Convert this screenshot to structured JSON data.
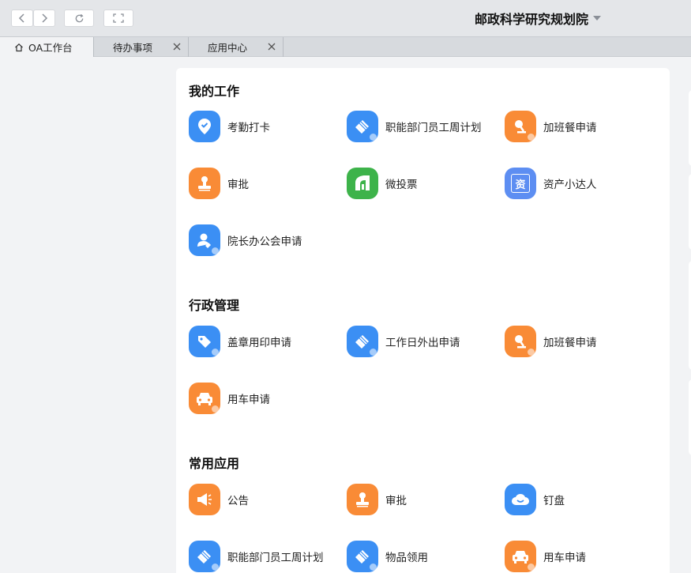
{
  "colors": {
    "blue": "#3b8ff4",
    "orange": "#f98b36",
    "green": "#3db34a",
    "periwinkle": "#5d8ef2"
  },
  "header": {
    "org_name": "邮政科学研究规划院",
    "back_icon": "chevron-left-icon",
    "forward_icon": "chevron-right-icon",
    "refresh_icon": "refresh-icon",
    "fullscreen_icon": "fullscreen-icon"
  },
  "tabs": [
    {
      "label": "OA工作台",
      "icon": "home-icon",
      "closable": false,
      "active": true
    },
    {
      "label": "待办事项",
      "closable": true,
      "active": false
    },
    {
      "label": "应用中心",
      "closable": true,
      "active": false
    }
  ],
  "sections": [
    {
      "title": "我的工作",
      "apps": [
        {
          "label": "考勤打卡",
          "icon": "location-check-icon",
          "color": "blue"
        },
        {
          "label": "职能部门员工周计划",
          "icon": "brush-icon",
          "color": "blue"
        },
        {
          "label": "加班餐申请",
          "icon": "lamp-icon",
          "color": "orange"
        },
        {
          "label": "审批",
          "icon": "stamp-icon",
          "color": "orange"
        },
        {
          "label": "微投票",
          "icon": "vote-box-icon",
          "color": "green"
        },
        {
          "label": "资产小达人",
          "icon": "asset-icon",
          "color": "periwinkle",
          "glyph": "资"
        },
        {
          "label": "院长办公会申请",
          "icon": "person-icon",
          "color": "blue"
        }
      ]
    },
    {
      "title": "行政管理",
      "apps": [
        {
          "label": "盖章用印申请",
          "icon": "tag-icon",
          "color": "blue"
        },
        {
          "label": "工作日外出申请",
          "icon": "brush-icon",
          "color": "blue"
        },
        {
          "label": "加班餐申请",
          "icon": "lamp-icon",
          "color": "orange"
        },
        {
          "label": "用车申请",
          "icon": "car-icon",
          "color": "orange"
        }
      ]
    },
    {
      "title": "常用应用",
      "apps": [
        {
          "label": "公告",
          "icon": "megaphone-icon",
          "color": "orange"
        },
        {
          "label": "审批",
          "icon": "stamp-icon",
          "color": "orange"
        },
        {
          "label": "钉盘",
          "icon": "cloud-icon",
          "color": "blue"
        },
        {
          "label": "职能部门员工周计划",
          "icon": "brush-icon",
          "color": "blue"
        },
        {
          "label": "物品领用",
          "icon": "brush-icon",
          "color": "blue"
        },
        {
          "label": "用车申请",
          "icon": "car-icon",
          "color": "orange"
        }
      ]
    }
  ]
}
